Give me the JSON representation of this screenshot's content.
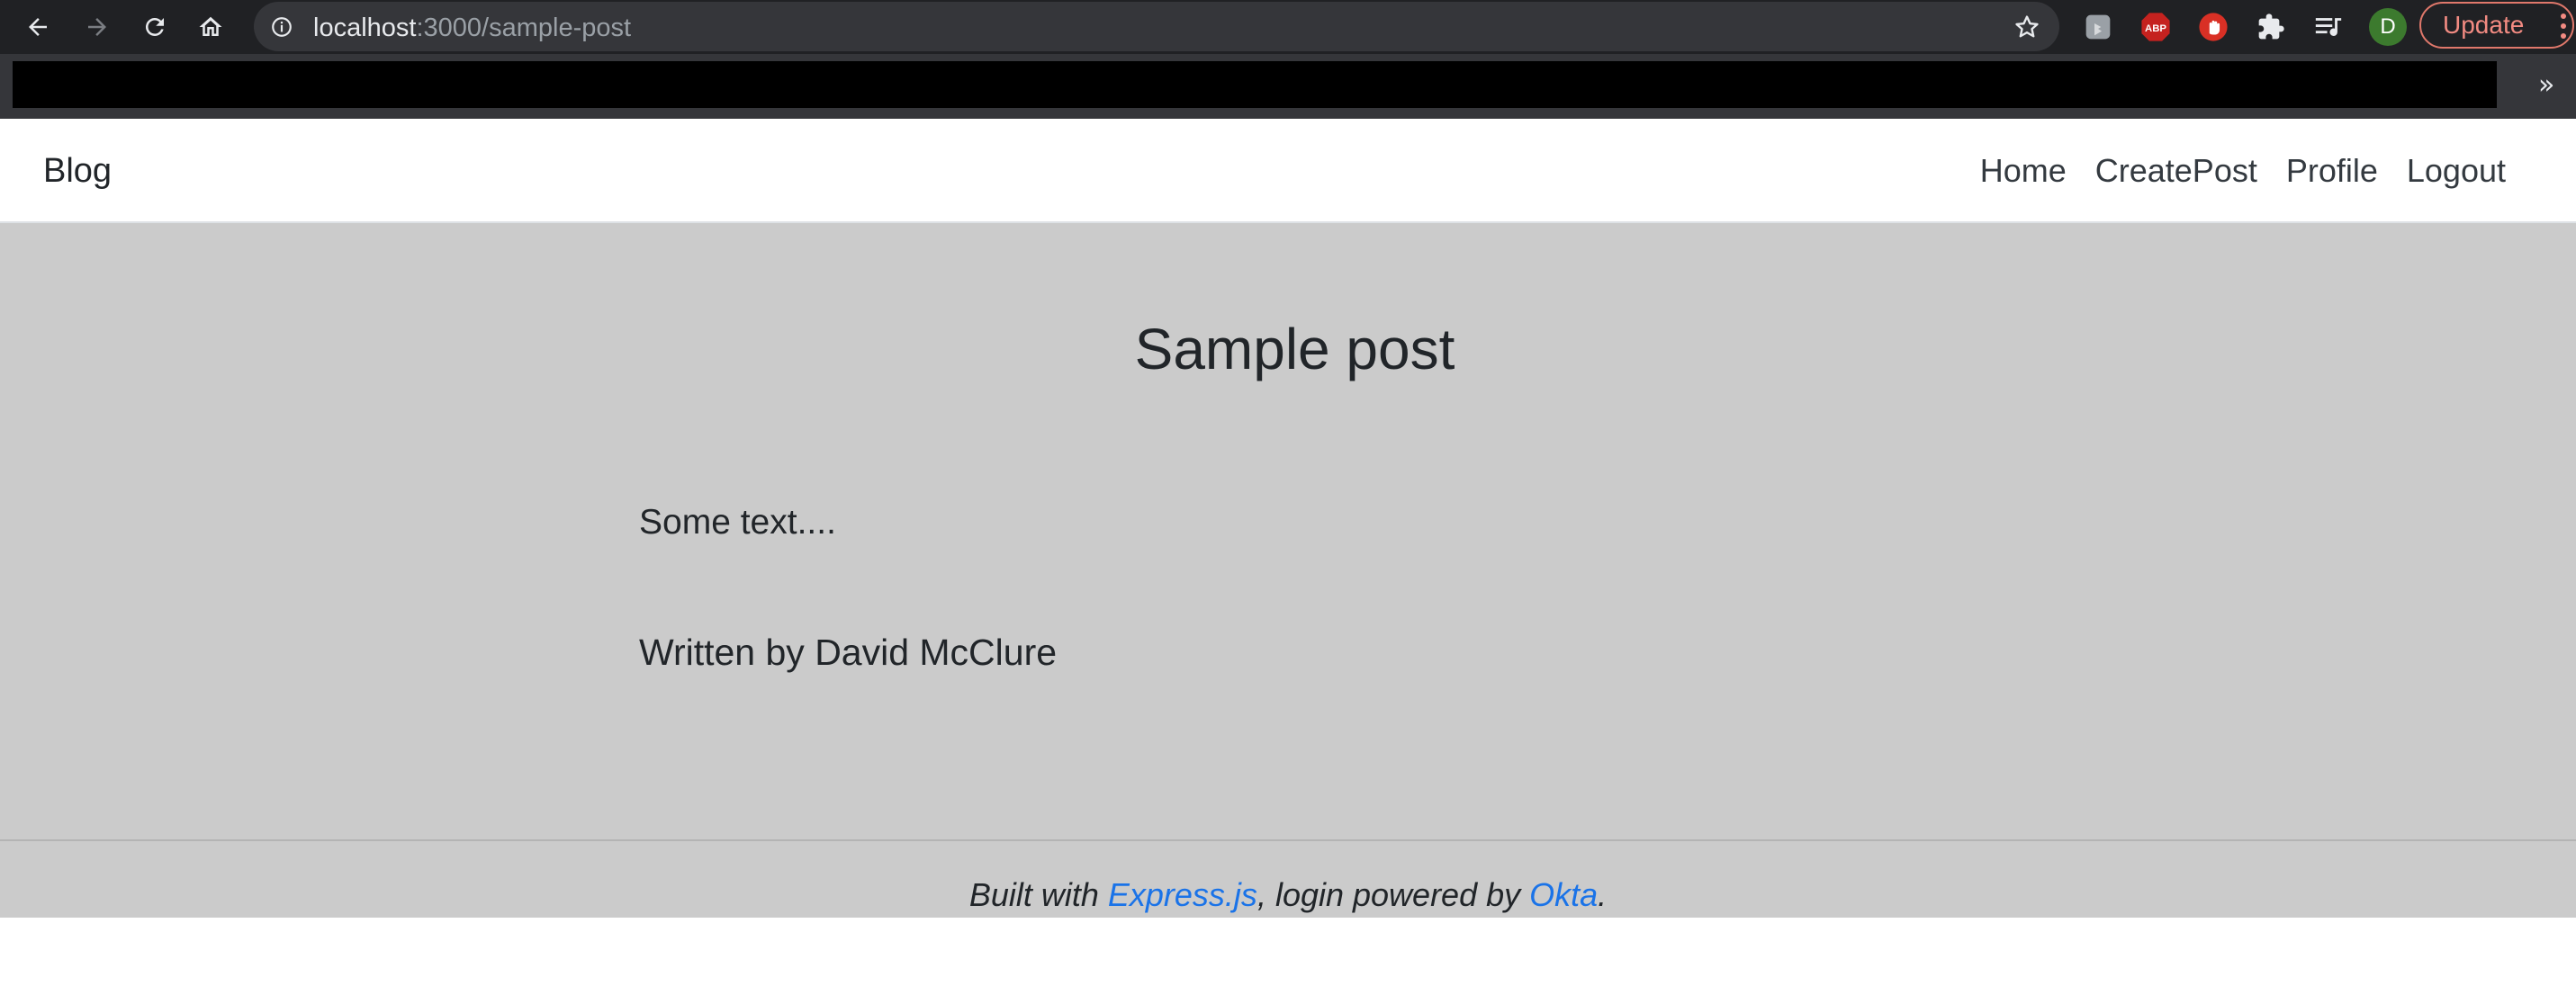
{
  "browser": {
    "url_host": "localhost",
    "url_path": ":3000/sample-post",
    "profile_initial": "D",
    "update_label": "Update",
    "extensions": [
      "bing-extension-icon",
      "adblock-plus-icon",
      "hand-stop-icon",
      "puzzle-extensions-icon",
      "media-playlist-icon"
    ],
    "overflow_chevron": "»"
  },
  "navbar": {
    "brand": "Blog",
    "links": [
      "Home",
      "CreatePost",
      "Profile",
      "Logout"
    ]
  },
  "post": {
    "title": "Sample post",
    "body": "Some text....",
    "author_line": "Written by David McClure"
  },
  "footer": {
    "prefix": "Built with ",
    "express_link": "Express.js",
    "middle": ", login powered by ",
    "okta_link": "Okta",
    "suffix": "."
  },
  "colors": {
    "chrome_dark": "#202124",
    "omnibox": "#35363a",
    "page_bg": "#cbcbcb",
    "link": "#1a73e8",
    "update_accent": "#f28b82",
    "avatar": "#3c7a2e"
  }
}
